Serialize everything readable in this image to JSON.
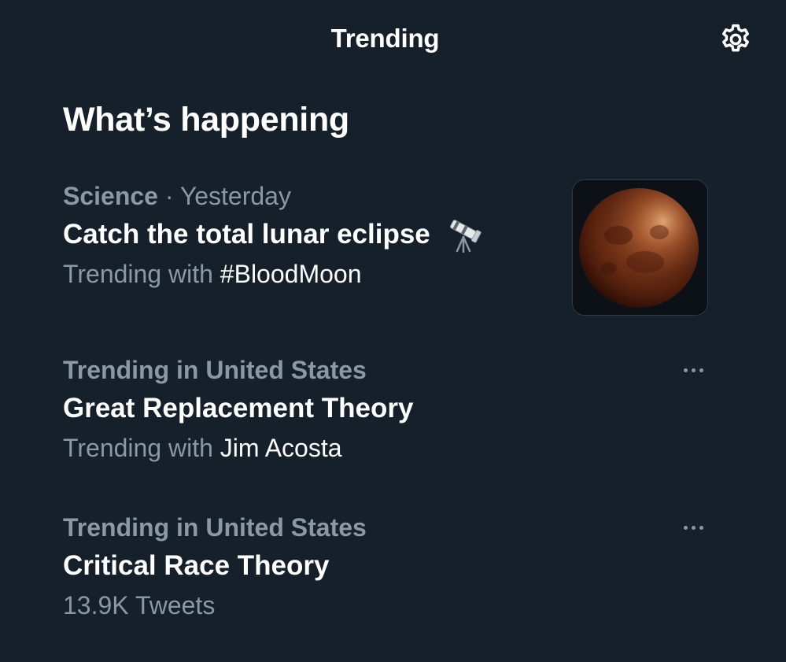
{
  "header": {
    "title": "Trending",
    "settings_icon": "gear-icon"
  },
  "section": {
    "title": "What’s happening"
  },
  "trends": [
    {
      "category": "Science",
      "separator": " · ",
      "time": "Yesterday",
      "name": "Catch the total lunar eclipse",
      "emoji_icon": "telescope-icon",
      "sub_prefix": "Trending with ",
      "sub_highlight": "#BloodMoon",
      "thumbnail": "blood-moon-image"
    },
    {
      "context": "Trending in United States",
      "name": "Great Replacement Theory",
      "sub_prefix": "Trending with ",
      "sub_highlight": "Jim Acosta",
      "more_icon": "more-icon"
    },
    {
      "context": "Trending in United States",
      "name": "Critical Race Theory",
      "sub": "13.9K Tweets",
      "more_icon": "more-icon"
    }
  ],
  "colors": {
    "background": "#15202b",
    "primary_text": "#ffffff",
    "secondary_text": "#8b98a5"
  }
}
